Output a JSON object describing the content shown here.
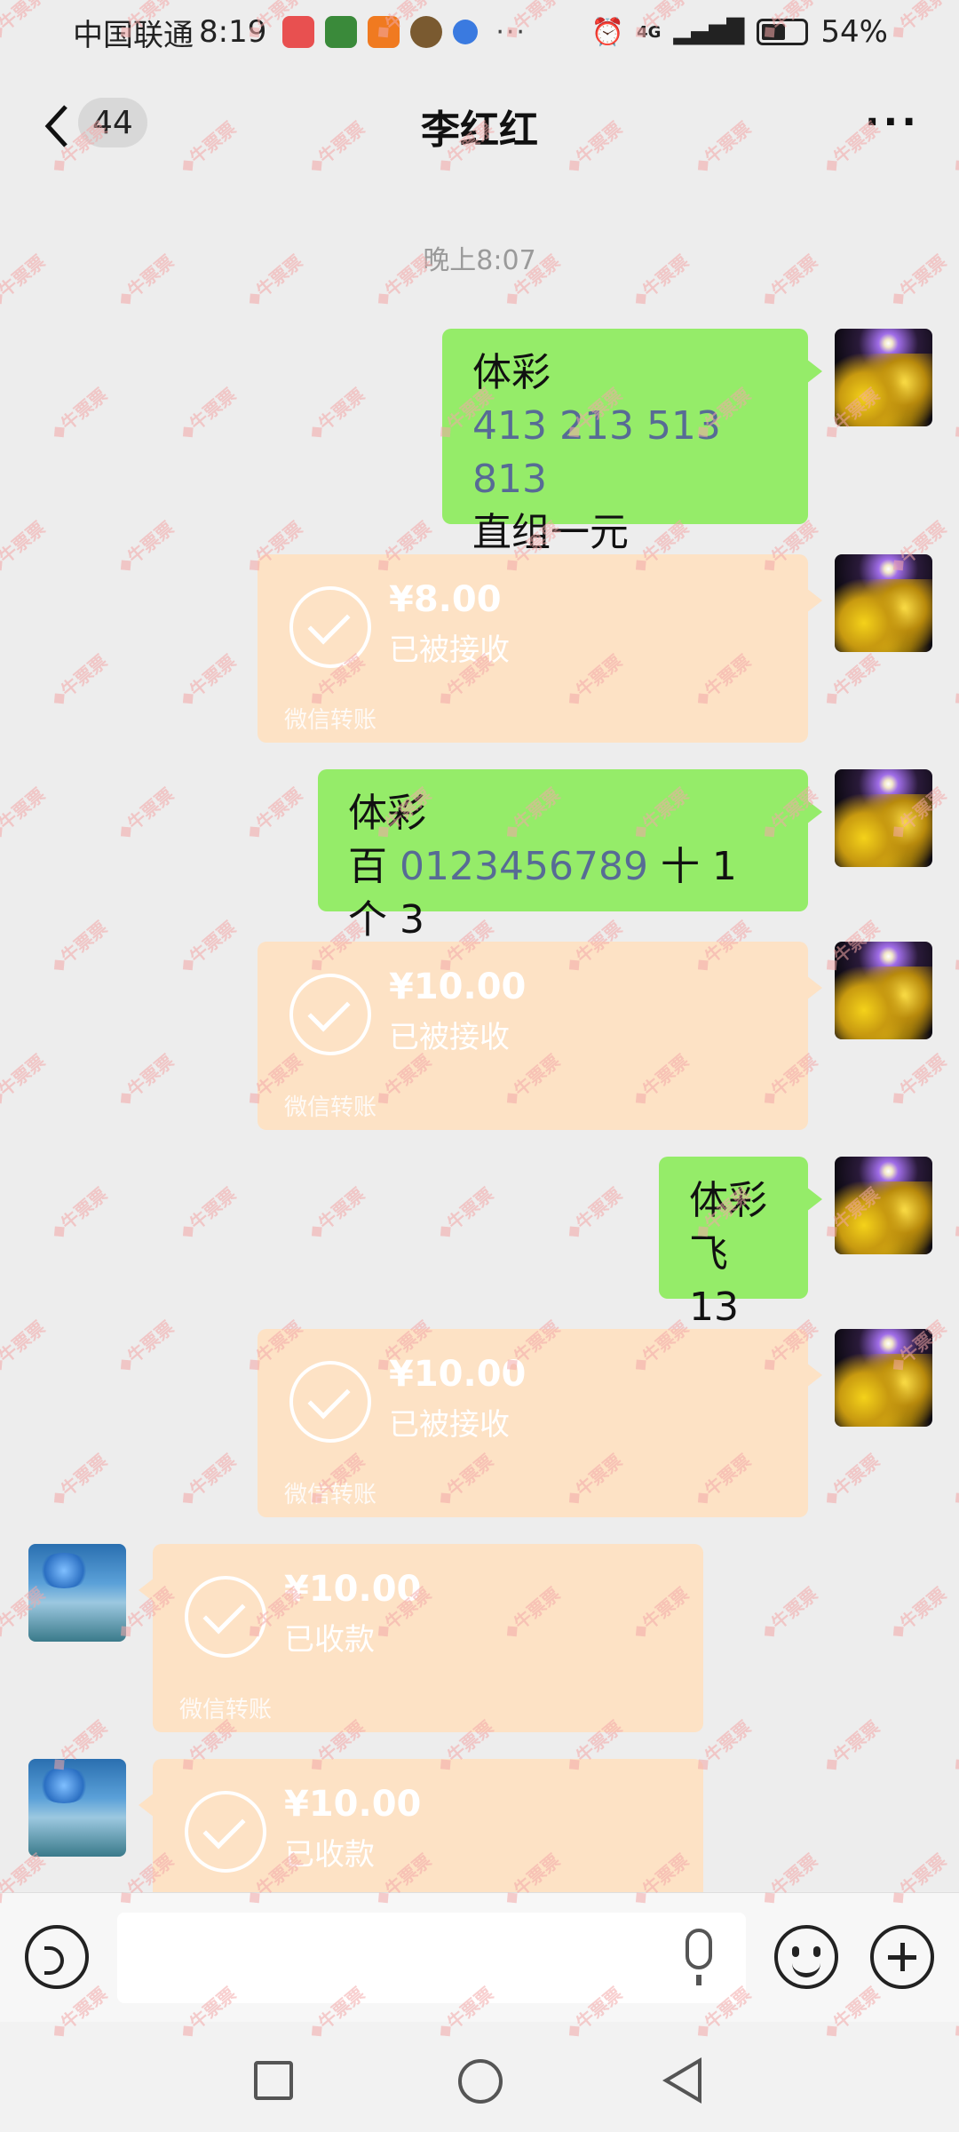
{
  "status": {
    "carrier": "中国联通",
    "time": "8:19",
    "more": "···",
    "network": "4G",
    "battery": "54%"
  },
  "header": {
    "unread_count": "44",
    "title": "李红红",
    "more_label": "···"
  },
  "chat": {
    "timestamp": "晚上8:07",
    "messages": [
      {
        "line1": "体彩",
        "line2": "413 213 513 813",
        "line3": "直组一元"
      },
      {
        "amount": "¥8.00",
        "status": "已被接收",
        "footer": "微信转账"
      },
      {
        "line1": "体彩",
        "prefix": "百 ",
        "digits": "0123456789",
        "suffix": " 十 1 个 3"
      },
      {
        "amount": "¥10.00",
        "status": "已被接收",
        "footer": "微信转账"
      },
      {
        "line1": "体彩",
        "line2": "飞 13"
      },
      {
        "amount": "¥10.00",
        "status": "已被接收",
        "footer": "微信转账"
      },
      {
        "amount": "¥10.00",
        "status": "已收款",
        "footer": "微信转账"
      },
      {
        "amount": "¥10.00",
        "status": "已收款"
      }
    ]
  },
  "watermark": "牛票票",
  "colors": {
    "green_bubble": "#95ec69",
    "transfer": "#fde2c5",
    "number_link": "#576b95"
  }
}
